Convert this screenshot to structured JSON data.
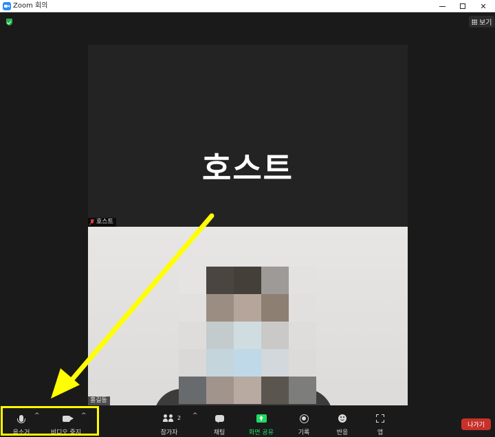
{
  "window": {
    "title": "Zoom 회의",
    "minimize_glyph": "",
    "close_glyph": "✕"
  },
  "header": {
    "view_label": "보기",
    "security_icon": "shield-check-icon"
  },
  "tiles": {
    "host": {
      "display_name": "호스트",
      "label": "호스트",
      "muted": true
    },
    "video": {
      "label": "홍길동",
      "mosaic": [
        [
          "#e6e4e2",
          "#4a4541",
          "#453f3a",
          "#9d9a97",
          "#e4e2e0"
        ],
        [
          "#e3e1df",
          "#9c8d82",
          "#b6a59b",
          "#8e7f73",
          "#e2e0de"
        ],
        [
          "#dfdddb",
          "#c3cbcc",
          "#cfdde0",
          "#cac9c7",
          "#dfdddb"
        ],
        [
          "#dad9d8",
          "#c4d5dc",
          "#bfd9e8",
          "#d2d8db",
          "#dcdbd9"
        ],
        [
          "#686b6d",
          "#a1948c",
          "#b8aaa1",
          "#5b5550",
          "#7d7d7c"
        ]
      ]
    }
  },
  "toolbar": {
    "mute_label": "음소거",
    "video_label": "비디오 중지",
    "participants_label": "참가자",
    "participants_count": "2",
    "chat_label": "채팅",
    "share_label": "화면 공유",
    "record_label": "기록",
    "reactions_label": "반응",
    "apps_label": "앱",
    "leave_label": "나가기",
    "caret": "^"
  },
  "annotation": {
    "highlight_color": "#ffff00",
    "arrow_color": "#ffff00"
  },
  "colors": {
    "share_green": "#23d962",
    "leave_red": "#c8312a",
    "muted_red": "#e03e3e",
    "background": "#1a1a1a"
  }
}
